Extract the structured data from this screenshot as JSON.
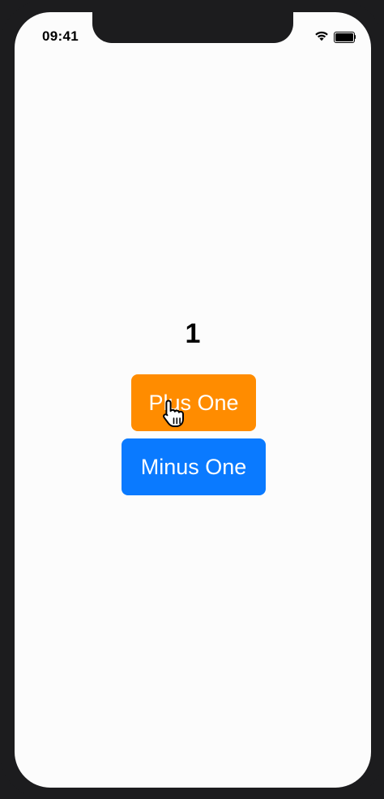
{
  "status_bar": {
    "time": "09:41",
    "icons": [
      "wifi-icon",
      "battery-icon"
    ]
  },
  "counter": {
    "value": "1"
  },
  "buttons": {
    "plus_label": "Plus One",
    "minus_label": "Minus One"
  },
  "colors": {
    "plus_button": "#ff8c00",
    "minus_button": "#0a7aff",
    "screen_background": "#fcfcfc",
    "device_frame": "#1c1c1e"
  },
  "cursor": {
    "icon": "hand-pointer-icon"
  }
}
